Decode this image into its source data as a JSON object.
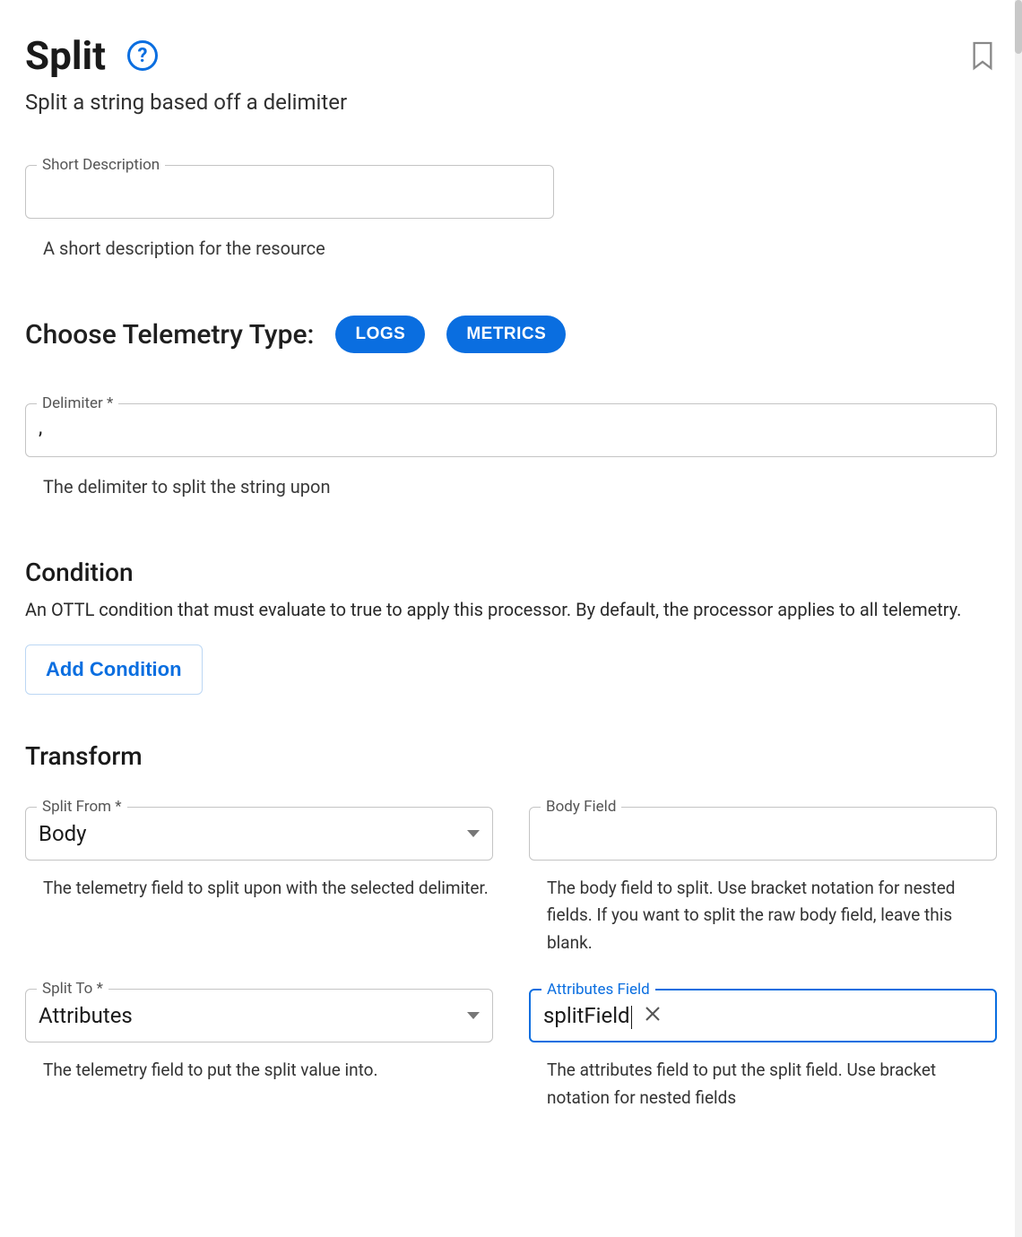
{
  "header": {
    "title": "Split",
    "subtitle": "Split a string based off a delimiter"
  },
  "shortDescription": {
    "label": "Short Description",
    "value": "",
    "helper": "A short description for the resource"
  },
  "telemetry": {
    "section_label": "Choose Telemetry Type:",
    "options": [
      "LOGS",
      "METRICS"
    ]
  },
  "delimiter": {
    "label": "Delimiter *",
    "value": ",",
    "helper": "The delimiter to split the string upon"
  },
  "condition": {
    "title": "Condition",
    "description": "An OTTL condition that must evaluate to true to apply this processor. By default, the processor applies to all telemetry.",
    "add_button": "Add Condition"
  },
  "transform": {
    "title": "Transform",
    "splitFrom": {
      "label": "Split From *",
      "value": "Body",
      "helper": "The telemetry field to split upon with the selected delimiter."
    },
    "bodyField": {
      "label": "Body Field",
      "value": "",
      "helper": "The body field to split. Use bracket notation for nested fields. If you want to split the raw body field, leave this blank."
    },
    "splitTo": {
      "label": "Split To *",
      "value": "Attributes",
      "helper": "The telemetry field to put the split value into."
    },
    "attributesField": {
      "label": "Attributes Field",
      "value": "splitField",
      "helper": "The attributes field to put the split field. Use bracket notation for nested fields"
    }
  }
}
